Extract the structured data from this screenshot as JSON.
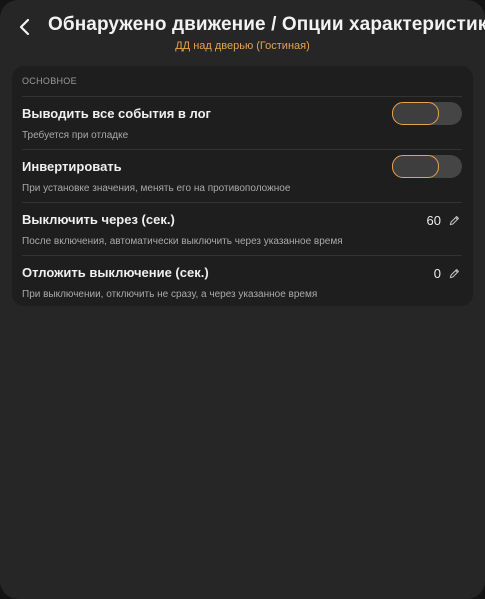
{
  "header": {
    "back_icon": "chevron-left-icon",
    "title": "Обнаружено движение / Опции характеристики",
    "subtitle": "ДД над дверью (Гостиная)"
  },
  "section": {
    "label": "ОСНОВНОЕ",
    "items": [
      {
        "title": "Выводить все события в лог",
        "description": "Требуется при отладке",
        "control": "toggle",
        "enabled": false
      },
      {
        "title": "Инвертировать",
        "description": "При установке значения, менять его на противоположное",
        "control": "toggle",
        "enabled": false
      },
      {
        "title": "Выключить через (сек.)",
        "description": "После включения, автоматически выключить через указанное время",
        "control": "value",
        "value": "60",
        "edit_icon": "pencil-icon"
      },
      {
        "title": "Отложить выключение (сек.)",
        "description": "При выключении, отключить не сразу, а через указанное время",
        "control": "value",
        "value": "0",
        "edit_icon": "pencil-icon"
      }
    ]
  },
  "colors": {
    "accent": "#e9a24c",
    "background": "#262626",
    "card": "#1e1e1e",
    "text": "#ececec",
    "muted": "#a9a9a9"
  }
}
